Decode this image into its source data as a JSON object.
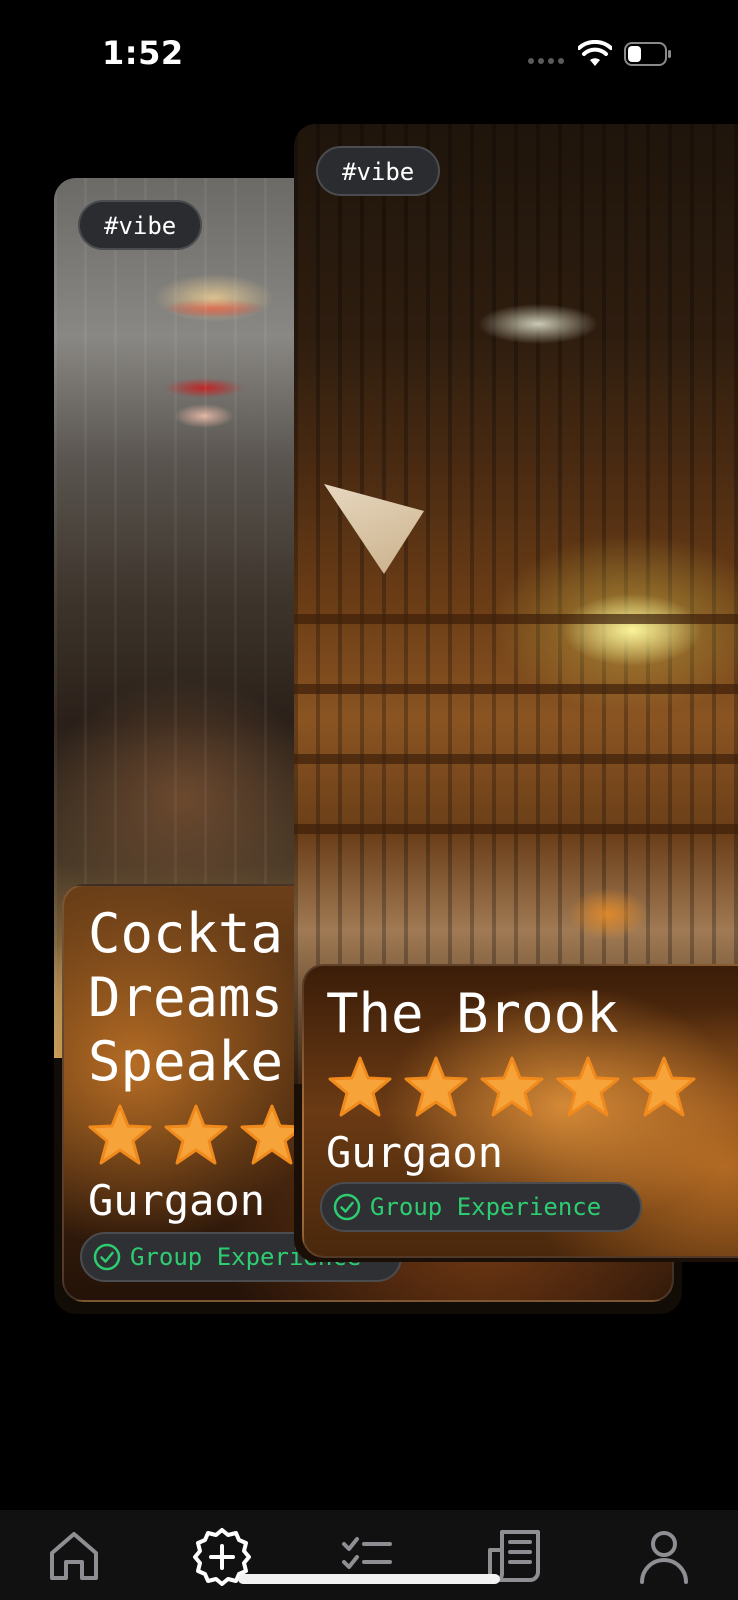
{
  "status_bar": {
    "time": "1:52",
    "icons": [
      "cellular-signal-icon",
      "wifi-icon",
      "battery-icon"
    ]
  },
  "cards": [
    {
      "tag": "#vibe",
      "name": "Cockta\nDreams\nSpeake",
      "rating": 5,
      "city": "Gurgaon",
      "badge": "Group Experience"
    },
    {
      "tag": "#vibe",
      "name": "The Brook",
      "rating": 5,
      "city": "Gurgaon",
      "badge": "Group Experience"
    }
  ],
  "bottom_nav": {
    "items": [
      {
        "icon": "home-icon"
      },
      {
        "icon": "add-circle-icon"
      },
      {
        "icon": "checklist-icon"
      },
      {
        "icon": "newspaper-icon"
      },
      {
        "icon": "profile-icon"
      }
    ]
  },
  "colors": {
    "background": "#000000",
    "star": "#f6a33a",
    "badge_text": "#2ecc71",
    "tag_bg": "#2a2c30"
  }
}
